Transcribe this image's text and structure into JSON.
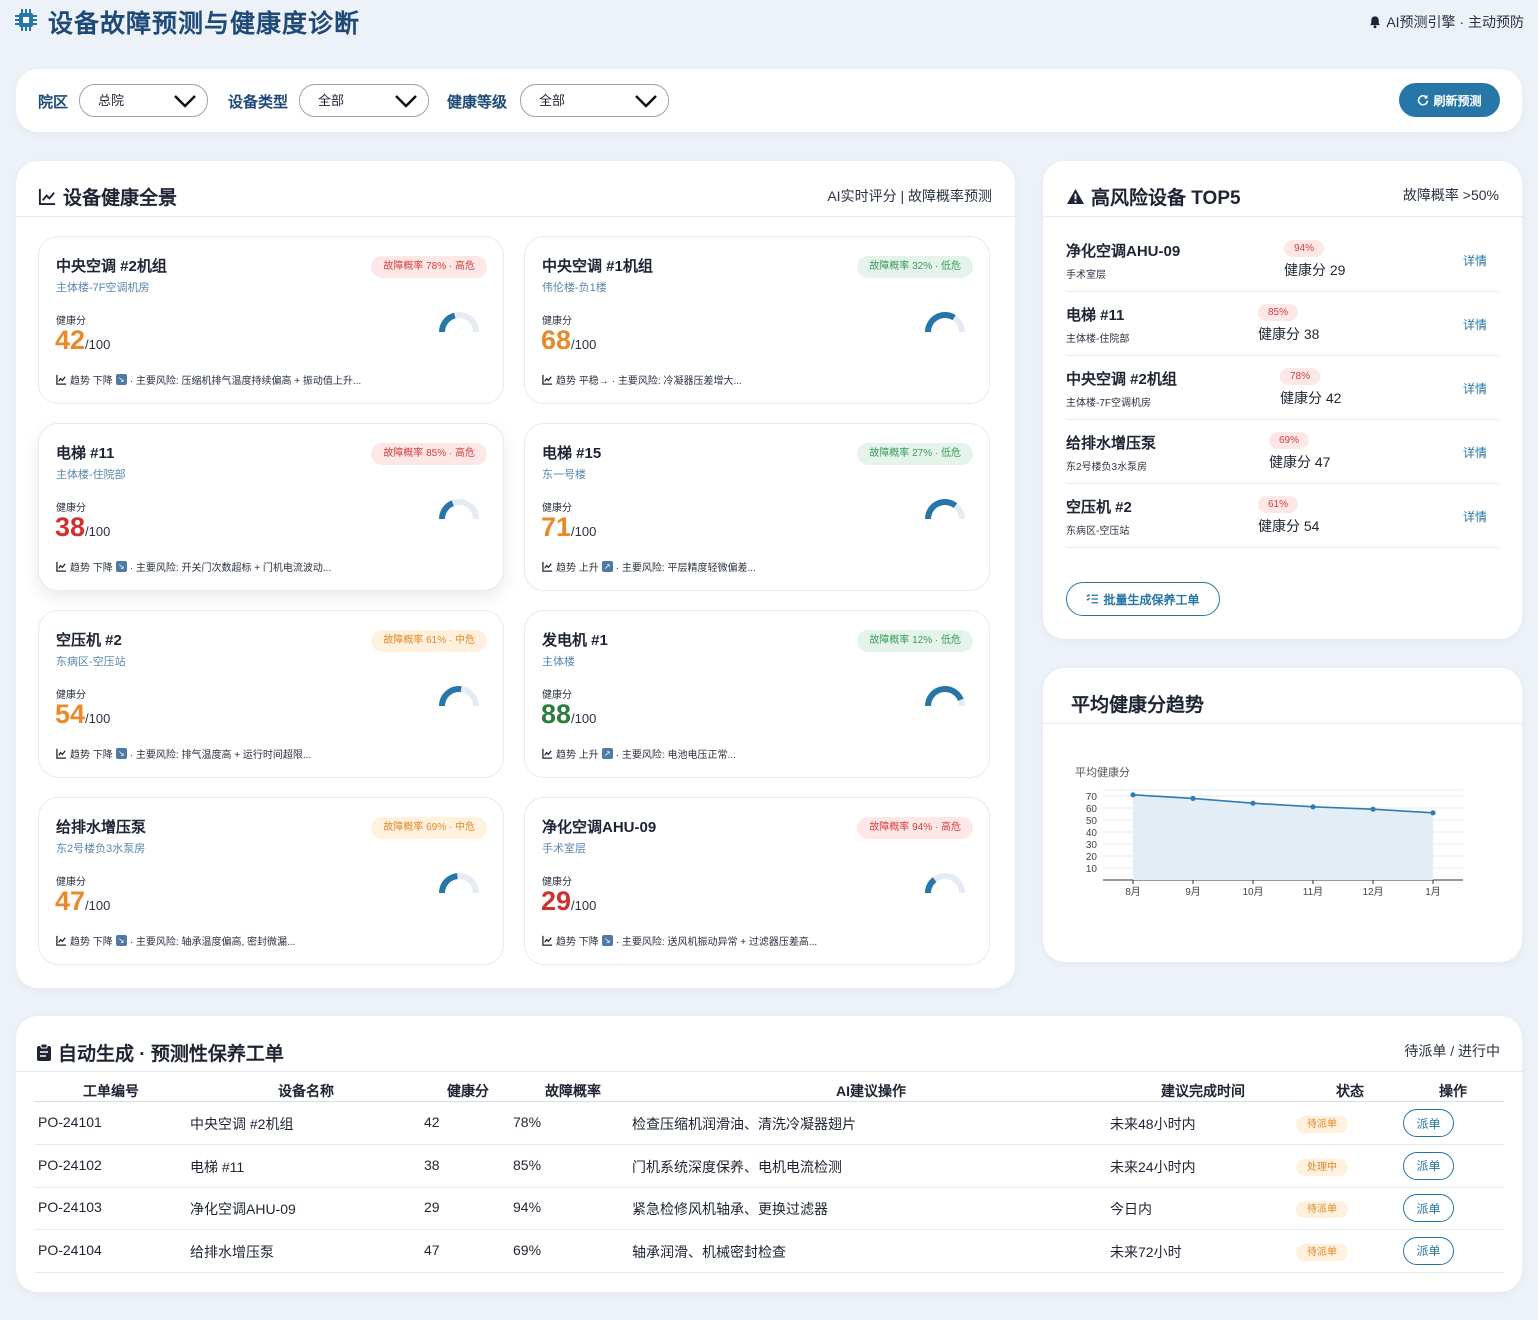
{
  "header": {
    "title": "设备故障预测与健康度诊断",
    "right_text": "AI预测引擎 · 主动预防"
  },
  "filters": {
    "campus_label": "院区",
    "campus_value": "总院",
    "type_label": "设备类型",
    "type_value": "全部",
    "level_label": "健康等级",
    "level_value": "全部",
    "refresh_label": "刷新预测"
  },
  "overview": {
    "title": "设备健康全景",
    "subtitle": "AI实时评分 | 故障概率预测",
    "score_label": "健康分",
    "score_suffix": "/100",
    "devices": [
      {
        "name": "中央空调 #2机组",
        "location": "主体楼-7F空调机房",
        "badge": "故障概率 78% · 高危",
        "level": "high",
        "score": "42",
        "health": 42,
        "trend": "趋势 下降",
        "risk": "· 主要风险: 压缩机排气温度持续偏高 + 振动值上升..."
      },
      {
        "name": "中央空调 #1机组",
        "location": "伟伦楼-负1楼",
        "badge": "故障概率 32% · 低危",
        "level": "low",
        "score": "68",
        "health": 68,
        "trend": "趋势 平稳→",
        "risk": "· 主要风险: 冷凝器压差增大..."
      },
      {
        "name": "电梯 #11",
        "location": "主体楼-住院部",
        "badge": "故障概率 85% · 高危",
        "level": "high",
        "score": "38",
        "health": 38,
        "trend": "趋势 下降",
        "risk": "· 主要风险: 开关门次数超标 + 门机电流波动..."
      },
      {
        "name": "电梯 #15",
        "location": "东一号楼",
        "badge": "故障概率 27% · 低危",
        "level": "low",
        "score": "71",
        "health": 71,
        "trend": "趋势 上升",
        "risk": "· 主要风险: 平层精度轻微偏差..."
      },
      {
        "name": "空压机 #2",
        "location": "东病区-空压站",
        "badge": "故障概率 61% · 中危",
        "level": "mid",
        "score": "54",
        "health": 54,
        "trend": "趋势 下降",
        "risk": "· 主要风险: 排气温度高 + 运行时间超限..."
      },
      {
        "name": "发电机 #1",
        "location": "主体楼",
        "badge": "故障概率 12% · 低危",
        "level": "low",
        "score": "88",
        "health": 88,
        "trend": "趋势 上升",
        "risk": "· 主要风险: 电池电压正常..."
      },
      {
        "name": "给排水增压泵",
        "location": "东2号楼负3水泵房",
        "badge": "故障概率 69% · 中危",
        "level": "mid",
        "score": "47",
        "health": 47,
        "trend": "趋势 下降",
        "risk": "· 主要风险: 轴承温度偏高, 密封微漏..."
      },
      {
        "name": "净化空调AHU-09",
        "location": "手术室层",
        "badge": "故障概率 94% · 高危",
        "level": "high",
        "score": "29",
        "health": 29,
        "trend": "趋势 下降",
        "risk": "· 主要风险: 送风机振动异常 + 过滤器压差高..."
      }
    ]
  },
  "risk": {
    "title": "高风险设备 TOP5",
    "subtitle": "故障概率 >50%",
    "detail_label": "详情",
    "items": [
      {
        "name": "净化空调AHU-09",
        "location": "手术室层",
        "pct": "94%",
        "score": "健康分 29"
      },
      {
        "name": "电梯 #11",
        "location": "主体楼-住院部",
        "pct": "85%",
        "score": "健康分 38"
      },
      {
        "name": "中央空调 #2机组",
        "location": "主体楼-7F空调机房",
        "pct": "78%",
        "score": "健康分 42"
      },
      {
        "name": "给排水增压泵",
        "location": "东2号楼负3水泵房",
        "pct": "69%",
        "score": "健康分 47"
      },
      {
        "name": "空压机 #2",
        "location": "东病区-空压站",
        "pct": "61%",
        "score": "健康分 54"
      }
    ],
    "batch_label": "批量生成保养工单"
  },
  "trend_panel": {
    "title": "平均健康分趋势"
  },
  "chart_data": {
    "type": "area",
    "ylabel": "平均健康分",
    "categories": [
      "8月",
      "9月",
      "10月",
      "11月",
      "12月",
      "1月"
    ],
    "series": [
      {
        "values": [
          71,
          68,
          64,
          61,
          59,
          56
        ]
      }
    ],
    "ylim": [
      0,
      75
    ],
    "yticks": [
      10,
      20,
      30,
      40,
      50,
      60,
      70
    ],
    "grid": true
  },
  "orders": {
    "title": "自动生成 · 预测性保养工单",
    "subtitle": "待派单 / 进行中",
    "headers": [
      "工单编号",
      "设备名称",
      "健康分",
      "故障概率",
      "AI建议操作",
      "建议完成时间",
      "状态",
      "操作"
    ],
    "dispatch_label": "派单",
    "rows": [
      {
        "id": "PO-24101",
        "device": "中央空调 #2机组",
        "score": "42",
        "prob": "78%",
        "action": "检查压缩机润滑油、清洗冷凝器翅片",
        "time": "未来48小时内",
        "status": "待派单"
      },
      {
        "id": "PO-24102",
        "device": "电梯 #11",
        "score": "38",
        "prob": "85%",
        "action": "门机系统深度保养、电机电流检测",
        "time": "未来24小时内",
        "status": "处理中"
      },
      {
        "id": "PO-24103",
        "device": "净化空调AHU-09",
        "score": "29",
        "prob": "94%",
        "action": "紧急检修风机轴承、更换过滤器",
        "time": "今日内",
        "status": "待派单"
      },
      {
        "id": "PO-24104",
        "device": "给排水增压泵",
        "score": "47",
        "prob": "69%",
        "action": "轴承润滑、机械密封检查",
        "time": "未来72小时",
        "status": "待派单"
      }
    ]
  },
  "colors": {
    "primary": "#2677a8",
    "title": "#1f4a78",
    "high": "#cf3030",
    "mid": "#e88a2a",
    "low": "#2f7d3e"
  }
}
